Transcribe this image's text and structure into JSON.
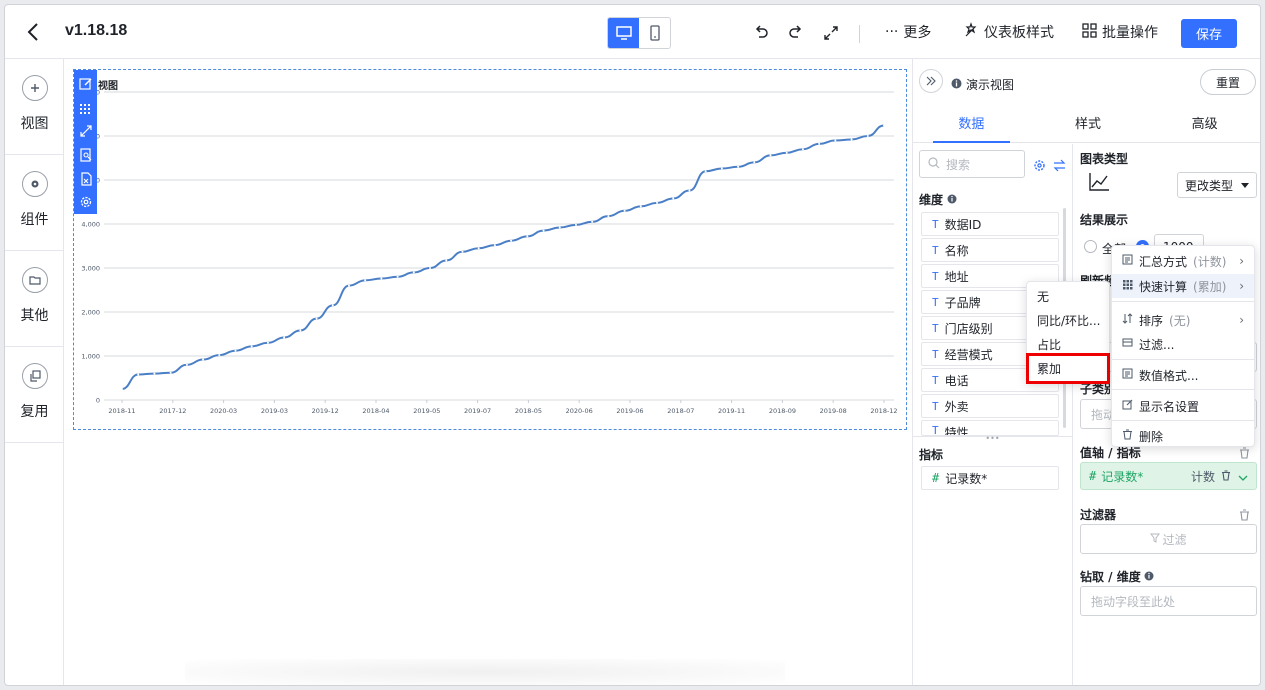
{
  "header": {
    "version": "v1.18.18",
    "more": "更多",
    "dashboard_style": "仪表板样式",
    "batch_ops": "批量操作",
    "save": "保存",
    "accent": "#3370ff"
  },
  "rail": {
    "items": [
      {
        "label": "视图",
        "icon": "plus-circle-icon"
      },
      {
        "label": "组件",
        "icon": "gear-icon"
      },
      {
        "label": "其他",
        "icon": "folder-icon"
      },
      {
        "label": "复用",
        "icon": "copy-icon"
      }
    ]
  },
  "chart_widget": {
    "title": "视图"
  },
  "chart_data": {
    "type": "line",
    "title": "视图",
    "xlabel": "",
    "ylabel": "",
    "ylim": [
      0,
      7000
    ],
    "y_ticks": [
      "0",
      "1,000",
      "2,000",
      "3,000",
      "4,000",
      "5,000",
      "6,000",
      "7,000"
    ],
    "x_tick_labels": [
      "2018-11",
      "2017-12",
      "2020-03",
      "2019-03",
      "2019-12",
      "2018-04",
      "2019-05",
      "2019-07",
      "2018-05",
      "2020-06",
      "2019-06",
      "2018-07",
      "2019-11",
      "2018-09",
      "2019-08",
      "2018-12"
    ],
    "grid": true,
    "color": "#4a7fc6",
    "series": [
      {
        "values": [
          250,
          580,
          600,
          620,
          800,
          920,
          1020,
          1120,
          1220,
          1300,
          1420,
          1580,
          1850,
          2150,
          2600,
          2720,
          2760,
          2800,
          2900,
          3000,
          3170,
          3370,
          3450,
          3520,
          3620,
          3720,
          3850,
          3920,
          3980,
          4050,
          4180,
          4300,
          4400,
          4480,
          4580,
          4760,
          5200,
          5260,
          5300,
          5400,
          5560,
          5620,
          5700,
          5820,
          5900,
          5920,
          6000,
          6240
        ]
      }
    ]
  },
  "panel": {
    "view_name": "演示视图",
    "reset": "重置",
    "tabs": [
      "数据",
      "样式",
      "高级"
    ],
    "search_placeholder": "搜索",
    "dimensions_title": "维度",
    "dimensions": [
      "数据ID",
      "名称",
      "地址",
      "子品牌",
      "门店级别",
      "经营模式",
      "电话",
      "外卖",
      "特性"
    ],
    "metrics_title": "指标",
    "metrics": [
      "记录数*"
    ],
    "chart_type_label": "图表类型",
    "change_type": "更改类型",
    "result_label": "结果展示",
    "result_all": "全部",
    "result_limit": "1000",
    "refresh_label": "刷新频",
    "drill_field_label": "子类别",
    "drill_placeholder": "拖动",
    "value_axis_label": "值轴 / 指标",
    "value_pill": "记录数*",
    "value_pill_agg": "计数",
    "filter_label": "过滤器",
    "filter_button": "过滤",
    "drill_dim_label": "钻取 / 维度",
    "drag_placeholder": "拖动字段至此处"
  },
  "context_menu": {
    "items": [
      {
        "label": "汇总方式",
        "hint": "(计数)"
      },
      {
        "label": "快速计算",
        "hint": "(累加)"
      },
      {
        "label": "排序",
        "hint": "(无)"
      },
      {
        "label": "过滤...",
        "hint": ""
      },
      {
        "label": "数值格式...",
        "hint": ""
      },
      {
        "label": "显示名设置",
        "hint": ""
      },
      {
        "label": "删除",
        "hint": ""
      }
    ]
  },
  "quick_calc_menu": {
    "items": [
      "无",
      "同比/环比...",
      "占比",
      "累加"
    ]
  }
}
